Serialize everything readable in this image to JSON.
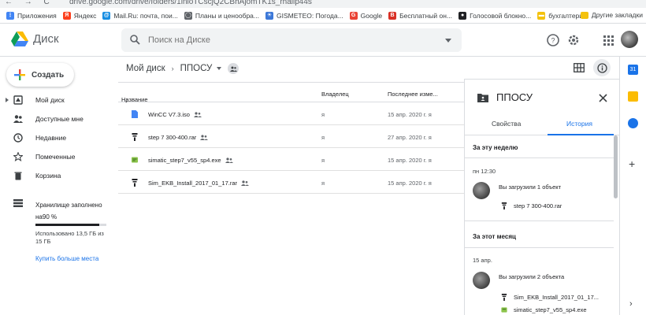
{
  "browser": {
    "url": "drive.google.com/drive/folders/1lnloTCscjQ2CBhAjomTK1s_rhalip44s",
    "bookmarks": [
      {
        "label": "Приложения",
        "icon": "apps-grid-icon",
        "color": "#4285f4"
      },
      {
        "label": "Яндекс",
        "icon": "yandex-icon",
        "color": "#fc3f1d"
      },
      {
        "label": "Mail.Ru: почта, пои...",
        "icon": "mailru-icon",
        "color": "#168de2"
      },
      {
        "label": "Планы и ценообра...",
        "icon": "globe-icon",
        "color": "#5f6368"
      },
      {
        "label": "GISMETEO: Погода...",
        "icon": "gismeteo-icon",
        "color": "#3c78d8"
      },
      {
        "label": "Google",
        "icon": "google-icon",
        "color": "#ea4335"
      },
      {
        "label": "Бесплатный он...",
        "icon": "free-service-icon",
        "color": "#d93025"
      },
      {
        "label": "Голосовой блокно...",
        "icon": "voice-notebook-icon",
        "color": "#202124"
      },
      {
        "label": "бухгалтерия",
        "icon": "folder-icon",
        "color": "#f4c20d"
      }
    ],
    "other_bookmarks": "Другие закладки"
  },
  "header": {
    "logo_text": "Диск",
    "search_placeholder": "Поиск на Диске"
  },
  "nav": {
    "create_label": "Создать",
    "items": [
      {
        "label": "Мой диск",
        "icon": "my-drive-icon"
      },
      {
        "label": "Доступные мне",
        "icon": "shared-with-me-icon"
      },
      {
        "label": "Недавние",
        "icon": "recent-clock-icon"
      },
      {
        "label": "Помеченные",
        "icon": "star-icon"
      },
      {
        "label": "Корзина",
        "icon": "trash-icon"
      }
    ],
    "storage": {
      "title_line1": "Хранилище заполнено",
      "title_line2": "на90 %",
      "used_fraction": 0.9,
      "usage_line1": "Использовано 13,5 ГБ из",
      "usage_line2": "15 ГБ",
      "buy_more": "Купить больше места"
    }
  },
  "main": {
    "breadcrumb_root": "Мой диск",
    "breadcrumb_current": "ППОСУ",
    "columns": {
      "name": "Название",
      "owner": "Владелец",
      "modified": "Последнее изме..."
    },
    "files": [
      {
        "name": "WinCC V7.3.iso",
        "owner": "я",
        "modified": "15 апр. 2020 г. я",
        "shared": true,
        "icon": "doc-file-icon",
        "color": "#4285f4"
      },
      {
        "name": "step 7 300-400.rar",
        "owner": "я",
        "modified": "27 апр. 2020 г. я",
        "shared": true,
        "icon": "archive-file-icon",
        "color": "#202124"
      },
      {
        "name": "simatic_step7_v55_sp4.exe",
        "owner": "я",
        "modified": "15 апр. 2020 г. я",
        "shared": true,
        "icon": "exe-file-icon",
        "color": "#8bc34a"
      },
      {
        "name": "Sim_EKB_Install_2017_01_17.rar",
        "owner": "я",
        "modified": "15 апр. 2020 г. я",
        "shared": true,
        "icon": "archive-file-icon",
        "color": "#202124"
      }
    ]
  },
  "details": {
    "title": "ППОСУ",
    "tab_properties": "Свойства",
    "tab_history": "История",
    "sections": [
      {
        "heading": "За эту неделю",
        "time": "пн 12:30",
        "action": "Вы загрузили 1 объект",
        "files": [
          {
            "name": "step 7 300-400.rar"
          }
        ]
      },
      {
        "heading": "За этот месяц",
        "time": "15 апр.",
        "action": "Вы загрузили 2 объекта",
        "files": [
          {
            "name": "Sim_EKB_Install_2017_01_17..."
          },
          {
            "name": "simatic_step7_v55_sp4.exe"
          }
        ]
      }
    ]
  },
  "colors": {
    "accent": "#1a73e8",
    "divider": "#dadce0"
  }
}
